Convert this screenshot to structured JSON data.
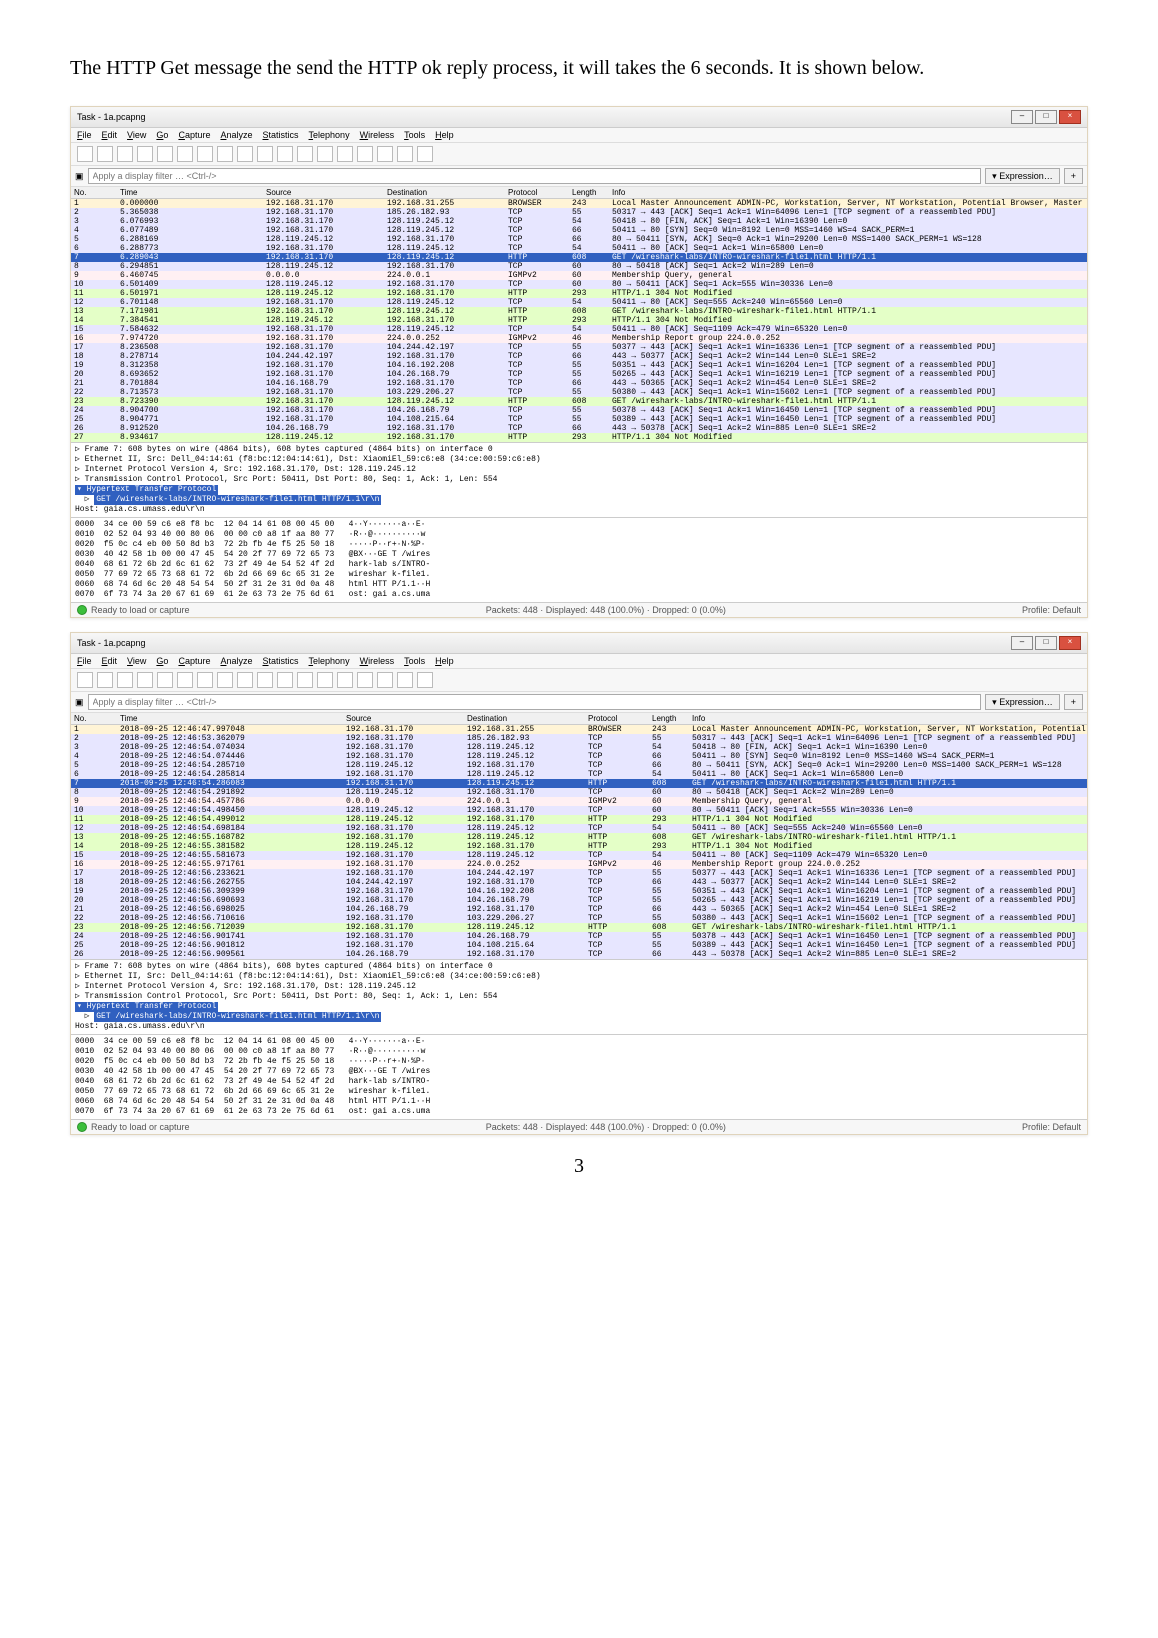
{
  "description": "The HTTP Get message the send the HTTP ok reply process, it will takes the 6 seconds. It is shown below.",
  "page_number": "3",
  "shared": {
    "menus": [
      "File",
      "Edit",
      "View",
      "Go",
      "Capture",
      "Analyze",
      "Statistics",
      "Telephony",
      "Wireless",
      "Tools",
      "Help"
    ],
    "columns": [
      "No.",
      "Time",
      "Source",
      "Destination",
      "Protocol",
      "Length",
      "Info"
    ],
    "filter_placeholder": "Apply a display filter … <Ctrl-/>",
    "expression_btn": "Expression…",
    "status_left": "Ready to load or capture",
    "profile": "Profile: Default",
    "title": "Task - 1a.pcapng"
  },
  "details_common": [
    "▷ Frame 7: 608 bytes on wire (4864 bits), 608 bytes captured (4864 bits) on interface 0",
    "▷ Ethernet II, Src: Dell_04:14:61 (f8:bc:12:04:14:61), Dst: XiaomiEl_59:c6:e8 (34:ce:00:59:c6:e8)",
    "▷ Internet Protocol Version 4, Src: 192.168.31.170, Dst: 128.119.245.12",
    "▷ Transmission Control Protocol, Src Port: 50411, Dst Port: 80, Seq: 1, Ack: 1, Len: 554"
  ],
  "details_http_hdr": "▾ Hypertext Transfer Protocol",
  "details_http_get": "GET /wireshark-labs/INTRO-wireshark-file1.html HTTP/1.1\\r\\n",
  "details_http_host": "    Host: gaia.cs.umass.edu\\r\\n",
  "hex": [
    "0000  34 ce 00 59 c6 e8 f8 bc  12 04 14 61 08 00 45 00   4··Y·······a··E·",
    "0010  02 52 04 93 40 00 80 06  00 00 c0 a8 1f aa 80 77   ·R··@··········w",
    "0020  f5 0c c4 eb 00 50 8d b3  72 2b fb 4e f5 25 50 18   ·····P··r+·N·%P·",
    "0030  40 42 58 1b 00 00 47 45  54 20 2f 77 69 72 65 73   @BX···GE T /wires",
    "0040  68 61 72 6b 2d 6c 61 62  73 2f 49 4e 54 52 4f 2d   hark-lab s/INTRO-",
    "0050  77 69 72 65 73 68 61 72  6b 2d 66 69 6c 65 31 2e   wireshar k-file1.",
    "0060  68 74 6d 6c 20 48 54 54  50 2f 31 2e 31 0d 0a 48   html HTT P/1.1··H",
    "0070  6f 73 74 3a 20 67 61 69  61 2e 63 73 2e 75 6d 61   ost: gai a.cs.uma"
  ],
  "cap1": {
    "status_right": "Packets: 448 · Displayed: 448 (100.0%) · Dropped: 0 (0.0%)",
    "rows": [
      {
        "c": "browser",
        "no": "1",
        "time": "0.000000",
        "src": "192.168.31.170",
        "dst": "192.168.31.255",
        "proto": "BROWSER",
        "len": "243",
        "info": "Local Master Announcement ADMIN-PC, Workstation, Server, NT Workstation, Potential Browser, Master Browser"
      },
      {
        "c": "tcp",
        "no": "2",
        "time": "5.365038",
        "src": "192.168.31.170",
        "dst": "185.26.182.93",
        "proto": "TCP",
        "len": "55",
        "info": "50317 → 443 [ACK] Seq=1 Ack=1 Win=64096 Len=1 [TCP segment of a reassembled PDU]"
      },
      {
        "c": "tcp",
        "no": "3",
        "time": "6.076993",
        "src": "192.168.31.170",
        "dst": "128.119.245.12",
        "proto": "TCP",
        "len": "54",
        "info": "50418 → 80 [FIN, ACK] Seq=1 Ack=1 Win=16390 Len=0"
      },
      {
        "c": "tcp",
        "no": "4",
        "time": "6.077489",
        "src": "192.168.31.170",
        "dst": "128.119.245.12",
        "proto": "TCP",
        "len": "66",
        "info": "50411 → 80 [SYN] Seq=0 Win=8192 Len=0 MSS=1460 WS=4 SACK_PERM=1"
      },
      {
        "c": "tcp",
        "no": "5",
        "time": "6.288169",
        "src": "128.119.245.12",
        "dst": "192.168.31.170",
        "proto": "TCP",
        "len": "66",
        "info": "80 → 50411 [SYN, ACK] Seq=0 Ack=1 Win=29200 Len=0 MSS=1400 SACK_PERM=1 WS=128"
      },
      {
        "c": "tcp",
        "no": "6",
        "time": "6.288773",
        "src": "192.168.31.170",
        "dst": "128.119.245.12",
        "proto": "TCP",
        "len": "54",
        "info": "50411 → 80 [ACK] Seq=1 Ack=1 Win=65800 Len=0"
      },
      {
        "c": "sel",
        "no": "7",
        "time": "6.289043",
        "src": "192.168.31.170",
        "dst": "128.119.245.12",
        "proto": "HTTP",
        "len": "608",
        "info": "GET /wireshark-labs/INTRO-wireshark-file1.html HTTP/1.1"
      },
      {
        "c": "tcp",
        "no": "8",
        "time": "6.294851",
        "src": "128.119.245.12",
        "dst": "192.168.31.170",
        "proto": "TCP",
        "len": "60",
        "info": "80 → 50418 [ACK] Seq=1 Ack=2 Win=289 Len=0"
      },
      {
        "c": "igmp",
        "no": "9",
        "time": "6.460745",
        "src": "0.0.0.0",
        "dst": "224.0.0.1",
        "proto": "IGMPv2",
        "len": "60",
        "info": "Membership Query, general"
      },
      {
        "c": "tcp",
        "no": "10",
        "time": "6.501409",
        "src": "128.119.245.12",
        "dst": "192.168.31.170",
        "proto": "TCP",
        "len": "60",
        "info": "80 → 50411 [ACK] Seq=1 Ack=555 Win=30336 Len=0"
      },
      {
        "c": "http",
        "no": "11",
        "time": "6.501971",
        "src": "128.119.245.12",
        "dst": "192.168.31.170",
        "proto": "HTTP",
        "len": "293",
        "info": "HTTP/1.1 304 Not Modified"
      },
      {
        "c": "tcp",
        "no": "12",
        "time": "6.701148",
        "src": "192.168.31.170",
        "dst": "128.119.245.12",
        "proto": "TCP",
        "len": "54",
        "info": "50411 → 80 [ACK] Seq=555 Ack=240 Win=65560 Len=0"
      },
      {
        "c": "http",
        "no": "13",
        "time": "7.171981",
        "src": "192.168.31.170",
        "dst": "128.119.245.12",
        "proto": "HTTP",
        "len": "608",
        "info": "GET /wireshark-labs/INTRO-wireshark-file1.html HTTP/1.1"
      },
      {
        "c": "http",
        "no": "14",
        "time": "7.384541",
        "src": "128.119.245.12",
        "dst": "192.168.31.170",
        "proto": "HTTP",
        "len": "293",
        "info": "HTTP/1.1 304 Not Modified"
      },
      {
        "c": "tcp",
        "no": "15",
        "time": "7.584632",
        "src": "192.168.31.170",
        "dst": "128.119.245.12",
        "proto": "TCP",
        "len": "54",
        "info": "50411 → 80 [ACK] Seq=1109 Ack=479 Win=65320 Len=0"
      },
      {
        "c": "igmp",
        "no": "16",
        "time": "7.974720",
        "src": "192.168.31.170",
        "dst": "224.0.0.252",
        "proto": "IGMPv2",
        "len": "46",
        "info": "Membership Report group 224.0.0.252"
      },
      {
        "c": "tcp",
        "no": "17",
        "time": "8.236508",
        "src": "192.168.31.170",
        "dst": "104.244.42.197",
        "proto": "TCP",
        "len": "55",
        "info": "50377 → 443 [ACK] Seq=1 Ack=1 Win=16336 Len=1 [TCP segment of a reassembled PDU]"
      },
      {
        "c": "tcp",
        "no": "18",
        "time": "8.278714",
        "src": "104.244.42.197",
        "dst": "192.168.31.170",
        "proto": "TCP",
        "len": "66",
        "info": "443 → 50377 [ACK] Seq=1 Ack=2 Win=144 Len=0 SLE=1 SRE=2"
      },
      {
        "c": "tcp",
        "no": "19",
        "time": "8.312358",
        "src": "192.168.31.170",
        "dst": "104.16.192.208",
        "proto": "TCP",
        "len": "55",
        "info": "50351 → 443 [ACK] Seq=1 Ack=1 Win=16204 Len=1 [TCP segment of a reassembled PDU]"
      },
      {
        "c": "tcp",
        "no": "20",
        "time": "8.693652",
        "src": "192.168.31.170",
        "dst": "104.26.168.79",
        "proto": "TCP",
        "len": "55",
        "info": "50265 → 443 [ACK] Seq=1 Ack=1 Win=16219 Len=1 [TCP segment of a reassembled PDU]"
      },
      {
        "c": "tcp",
        "no": "21",
        "time": "8.701884",
        "src": "104.16.168.79",
        "dst": "192.168.31.170",
        "proto": "TCP",
        "len": "66",
        "info": "443 → 50365 [ACK] Seq=1 Ack=2 Win=454 Len=0 SLE=1 SRE=2"
      },
      {
        "c": "tcp",
        "no": "22",
        "time": "8.713573",
        "src": "192.168.31.170",
        "dst": "103.229.206.27",
        "proto": "TCP",
        "len": "55",
        "info": "50380 → 443 [ACK] Seq=1 Ack=1 Win=15602 Len=1 [TCP segment of a reassembled PDU]"
      },
      {
        "c": "http",
        "no": "23",
        "time": "8.723390",
        "src": "192.168.31.170",
        "dst": "128.119.245.12",
        "proto": "HTTP",
        "len": "608",
        "info": "GET /wireshark-labs/INTRO-wireshark-file1.html HTTP/1.1"
      },
      {
        "c": "tcp",
        "no": "24",
        "time": "8.904700",
        "src": "192.168.31.170",
        "dst": "104.26.168.79",
        "proto": "TCP",
        "len": "55",
        "info": "50378 → 443 [ACK] Seq=1 Ack=1 Win=16450 Len=1 [TCP segment of a reassembled PDU]"
      },
      {
        "c": "tcp",
        "no": "25",
        "time": "8.904771",
        "src": "192.168.31.170",
        "dst": "104.108.215.64",
        "proto": "TCP",
        "len": "55",
        "info": "50389 → 443 [ACK] Seq=1 Ack=1 Win=16450 Len=1 [TCP segment of a reassembled PDU]"
      },
      {
        "c": "tcp",
        "no": "26",
        "time": "8.912520",
        "src": "104.26.168.79",
        "dst": "192.168.31.170",
        "proto": "TCP",
        "len": "66",
        "info": "443 → 50378 [ACK] Seq=1 Ack=2 Win=885 Len=0 SLE=1 SRE=2"
      },
      {
        "c": "http",
        "no": "27",
        "time": "8.934617",
        "src": "128.119.245.12",
        "dst": "192.168.31.170",
        "proto": "HTTP",
        "len": "293",
        "info": "HTTP/1.1 304 Not Modified"
      }
    ]
  },
  "cap2": {
    "status_right": "Packets: 448 · Displayed: 448 (100.0%) · Dropped: 0 (0.0%)",
    "rows": [
      {
        "c": "browser",
        "no": "1",
        "time": "2018-09-25 12:46:47.997048",
        "src": "192.168.31.170",
        "dst": "192.168.31.255",
        "proto": "BROWSER",
        "len": "243",
        "info": "Local Master Announcement ADMIN-PC, Workstation, Server, NT Workstation, Potential Browser, Master Browser"
      },
      {
        "c": "tcp",
        "no": "2",
        "time": "2018-09-25 12:46:53.362079",
        "src": "192.168.31.170",
        "dst": "185.26.182.93",
        "proto": "TCP",
        "len": "55",
        "info": "50317 → 443 [ACK] Seq=1 Ack=1 Win=64096 Len=1 [TCP segment of a reassembled PDU]"
      },
      {
        "c": "tcp",
        "no": "3",
        "time": "2018-09-25 12:46:54.074034",
        "src": "192.168.31.170",
        "dst": "128.119.245.12",
        "proto": "TCP",
        "len": "54",
        "info": "50418 → 80 [FIN, ACK] Seq=1 Ack=1 Win=16390 Len=0"
      },
      {
        "c": "tcp",
        "no": "4",
        "time": "2018-09-25 12:46:54.074446",
        "src": "192.168.31.170",
        "dst": "128.119.245.12",
        "proto": "TCP",
        "len": "66",
        "info": "50411 → 80 [SYN] Seq=0 Win=8192 Len=0 MSS=1460 WS=4 SACK_PERM=1"
      },
      {
        "c": "tcp",
        "no": "5",
        "time": "2018-09-25 12:46:54.285710",
        "src": "128.119.245.12",
        "dst": "192.168.31.170",
        "proto": "TCP",
        "len": "66",
        "info": "80 → 50411 [SYN, ACK] Seq=0 Ack=1 Win=29200 Len=0 MSS=1400 SACK_PERM=1 WS=128"
      },
      {
        "c": "tcp",
        "no": "6",
        "time": "2018-09-25 12:46:54.285814",
        "src": "192.168.31.170",
        "dst": "128.119.245.12",
        "proto": "TCP",
        "len": "54",
        "info": "50411 → 80 [ACK] Seq=1 Ack=1 Win=65800 Len=0"
      },
      {
        "c": "sel",
        "no": "7",
        "time": "2018-09-25 12:46:54.286083",
        "src": "192.168.31.170",
        "dst": "128.119.245.12",
        "proto": "HTTP",
        "len": "608",
        "info": "GET /wireshark-labs/INTRO-wireshark-file1.html HTTP/1.1"
      },
      {
        "c": "tcp",
        "no": "8",
        "time": "2018-09-25 12:46:54.291892",
        "src": "128.119.245.12",
        "dst": "192.168.31.170",
        "proto": "TCP",
        "len": "60",
        "info": "80 → 50418 [ACK] Seq=1 Ack=2 Win=289 Len=0"
      },
      {
        "c": "igmp",
        "no": "9",
        "time": "2018-09-25 12:46:54.457786",
        "src": "0.0.0.0",
        "dst": "224.0.0.1",
        "proto": "IGMPv2",
        "len": "60",
        "info": "Membership Query, general"
      },
      {
        "c": "tcp",
        "no": "10",
        "time": "2018-09-25 12:46:54.498450",
        "src": "128.119.245.12",
        "dst": "192.168.31.170",
        "proto": "TCP",
        "len": "60",
        "info": "80 → 50411 [ACK] Seq=1 Ack=555 Win=30336 Len=0"
      },
      {
        "c": "http",
        "no": "11",
        "time": "2018-09-25 12:46:54.499012",
        "src": "128.119.245.12",
        "dst": "192.168.31.170",
        "proto": "HTTP",
        "len": "293",
        "info": "HTTP/1.1 304 Not Modified"
      },
      {
        "c": "tcp",
        "no": "12",
        "time": "2018-09-25 12:46:54.698184",
        "src": "192.168.31.170",
        "dst": "128.119.245.12",
        "proto": "TCP",
        "len": "54",
        "info": "50411 → 80 [ACK] Seq=555 Ack=240 Win=65560 Len=0"
      },
      {
        "c": "http",
        "no": "13",
        "time": "2018-09-25 12:46:55.168782",
        "src": "192.168.31.170",
        "dst": "128.119.245.12",
        "proto": "HTTP",
        "len": "608",
        "info": "GET /wireshark-labs/INTRO-wireshark-file1.html HTTP/1.1"
      },
      {
        "c": "http",
        "no": "14",
        "time": "2018-09-25 12:46:55.381582",
        "src": "128.119.245.12",
        "dst": "192.168.31.170",
        "proto": "HTTP",
        "len": "293",
        "info": "HTTP/1.1 304 Not Modified"
      },
      {
        "c": "tcp",
        "no": "15",
        "time": "2018-09-25 12:46:55.581673",
        "src": "192.168.31.170",
        "dst": "128.119.245.12",
        "proto": "TCP",
        "len": "54",
        "info": "50411 → 80 [ACK] Seq=1109 Ack=479 Win=65320 Len=0"
      },
      {
        "c": "igmp",
        "no": "16",
        "time": "2018-09-25 12:46:55.971761",
        "src": "192.168.31.170",
        "dst": "224.0.0.252",
        "proto": "IGMPv2",
        "len": "46",
        "info": "Membership Report group 224.0.0.252"
      },
      {
        "c": "tcp",
        "no": "17",
        "time": "2018-09-25 12:46:56.233621",
        "src": "192.168.31.170",
        "dst": "104.244.42.197",
        "proto": "TCP",
        "len": "55",
        "info": "50377 → 443 [ACK] Seq=1 Ack=1 Win=16336 Len=1 [TCP segment of a reassembled PDU]"
      },
      {
        "c": "tcp",
        "no": "18",
        "time": "2018-09-25 12:46:56.262755",
        "src": "104.244.42.197",
        "dst": "192.168.31.170",
        "proto": "TCP",
        "len": "66",
        "info": "443 → 50377 [ACK] Seq=1 Ack=2 Win=144 Len=0 SLE=1 SRE=2"
      },
      {
        "c": "tcp",
        "no": "19",
        "time": "2018-09-25 12:46:56.309399",
        "src": "192.168.31.170",
        "dst": "104.16.192.208",
        "proto": "TCP",
        "len": "55",
        "info": "50351 → 443 [ACK] Seq=1 Ack=1 Win=16204 Len=1 [TCP segment of a reassembled PDU]"
      },
      {
        "c": "tcp",
        "no": "20",
        "time": "2018-09-25 12:46:56.690693",
        "src": "192.168.31.170",
        "dst": "104.26.168.79",
        "proto": "TCP",
        "len": "55",
        "info": "50265 → 443 [ACK] Seq=1 Ack=1 Win=16219 Len=1 [TCP segment of a reassembled PDU]"
      },
      {
        "c": "tcp",
        "no": "21",
        "time": "2018-09-25 12:46:56.698025",
        "src": "104.26.168.79",
        "dst": "192.168.31.170",
        "proto": "TCP",
        "len": "66",
        "info": "443 → 50365 [ACK] Seq=1 Ack=2 Win=454 Len=0 SLE=1 SRE=2"
      },
      {
        "c": "tcp",
        "no": "22",
        "time": "2018-09-25 12:46:56.710616",
        "src": "192.168.31.170",
        "dst": "103.229.206.27",
        "proto": "TCP",
        "len": "55",
        "info": "50380 → 443 [ACK] Seq=1 Ack=1 Win=15602 Len=1 [TCP segment of a reassembled PDU]"
      },
      {
        "c": "http",
        "no": "23",
        "time": "2018-09-25 12:46:56.712039",
        "src": "192.168.31.170",
        "dst": "128.119.245.12",
        "proto": "HTTP",
        "len": "608",
        "info": "GET /wireshark-labs/INTRO-wireshark-file1.html HTTP/1.1"
      },
      {
        "c": "tcp",
        "no": "24",
        "time": "2018-09-25 12:46:56.901741",
        "src": "192.168.31.170",
        "dst": "104.26.168.79",
        "proto": "TCP",
        "len": "55",
        "info": "50378 → 443 [ACK] Seq=1 Ack=1 Win=16450 Len=1 [TCP segment of a reassembled PDU]"
      },
      {
        "c": "tcp",
        "no": "25",
        "time": "2018-09-25 12:46:56.901812",
        "src": "192.168.31.170",
        "dst": "104.108.215.64",
        "proto": "TCP",
        "len": "55",
        "info": "50389 → 443 [ACK] Seq=1 Ack=1 Win=16450 Len=1 [TCP segment of a reassembled PDU]"
      },
      {
        "c": "tcp",
        "no": "26",
        "time": "2018-09-25 12:46:56.909561",
        "src": "104.26.168.79",
        "dst": "192.168.31.170",
        "proto": "TCP",
        "len": "66",
        "info": "443 → 50378 [ACK] Seq=1 Ack=2 Win=885 Len=0 SLE=1 SRE=2"
      }
    ]
  }
}
